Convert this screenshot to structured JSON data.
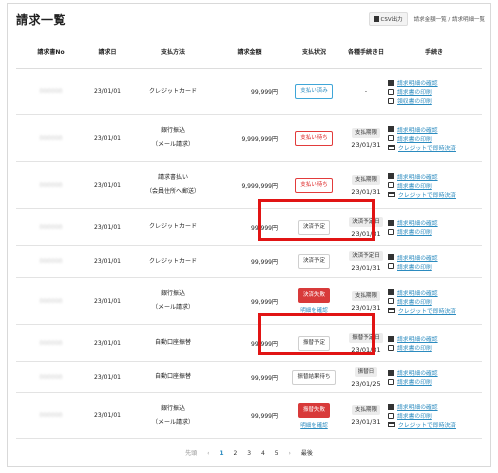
{
  "page": {
    "title": "請求一覧"
  },
  "toolbar": {
    "csv_label": "CSV出力",
    "breadcrumb_1": "請求金額一覧",
    "breadcrumb_sep": "/",
    "breadcrumb_2": "請求明細一覧"
  },
  "headers": [
    "請求書No",
    "請求日",
    "支払方法",
    "請求金額",
    "支払状況",
    "各種手続き日",
    "手続き"
  ],
  "rows": [
    {
      "no": "000000",
      "date": "23/01/01",
      "method1": "クレジットカード",
      "method2": "",
      "amount": "99,999円",
      "status": "支払い済み",
      "due_label": "",
      "due_date": "-",
      "actions": [
        "請求明細の確認",
        "請求書の印刷",
        "領収書の印刷"
      ]
    },
    {
      "no": "000000",
      "date": "23/01/01",
      "method1": "銀行振込",
      "method2": "（メール請求）",
      "amount": "9,999,999円",
      "status": "支払い待ち",
      "due_label": "支払期限",
      "due_date": "23/01/31",
      "actions": [
        "請求明細の確認",
        "請求書の印刷",
        "クレジットで即時決済"
      ]
    },
    {
      "no": "000000",
      "date": "23/01/01",
      "method1": "請求書払い",
      "method2": "（会員住所へ郵送）",
      "amount": "9,999,999円",
      "status": "支払い待ち",
      "due_label": "支払期限",
      "due_date": "23/01/31",
      "actions": [
        "請求明細の確認",
        "請求書の印刷",
        "クレジットで即時決済"
      ]
    },
    {
      "no": "000000",
      "date": "23/01/01",
      "method1": "クレジットカード",
      "method2": "",
      "amount": "99,999円",
      "status": "決済予定",
      "due_label": "決済予定日",
      "due_date": "23/01/31",
      "actions": [
        "請求明細の確認",
        "請求書の印刷"
      ]
    },
    {
      "no": "000000",
      "date": "23/01/01",
      "method1": "クレジットカード",
      "method2": "",
      "amount": "99,999円",
      "status": "決済予定",
      "due_label": "決済予定日",
      "due_date": "23/01/31",
      "actions": [
        "請求明細の確認",
        "請求書の印刷"
      ]
    },
    {
      "no": "000000",
      "date": "23/01/01",
      "method1": "銀行振込",
      "method2": "（メール請求）",
      "amount": "99,999円",
      "status": "決済失敗",
      "status_link": "明細を確認",
      "due_label": "支払期限",
      "due_date": "23/01/31",
      "actions": [
        "請求明細の確認",
        "請求書の印刷",
        "クレジットで即時決済"
      ]
    },
    {
      "no": "000000",
      "date": "23/01/01",
      "method1": "自動口座振替",
      "method2": "",
      "amount": "99,999円",
      "status": "振替予定",
      "due_label": "振替予定日",
      "due_date": "23/01/31",
      "actions": [
        "請求明細の確認",
        "請求書の印刷"
      ]
    },
    {
      "no": "000000",
      "date": "23/01/01",
      "method1": "自動口座振替",
      "method2": "",
      "amount": "99,999円",
      "status": "振替結果待ち",
      "due_label": "振替日",
      "due_date": "23/01/25",
      "actions": [
        "請求明細の確認",
        "請求書の印刷"
      ]
    },
    {
      "no": "000000",
      "date": "23/01/01",
      "method1": "銀行振込",
      "method2": "（メール請求）",
      "amount": "99,999円",
      "status": "振替失敗",
      "status_link": "明細を確認",
      "due_label": "支払期限",
      "due_date": "23/01/31",
      "actions": [
        "請求明細の確認",
        "請求書の印刷",
        "クレジットで即時決済"
      ]
    }
  ],
  "pager": {
    "first": "先頭",
    "prev": "‹",
    "pages": [
      "1",
      "2",
      "3",
      "4",
      "5"
    ],
    "current": "1",
    "next": "›",
    "last": "最後"
  }
}
